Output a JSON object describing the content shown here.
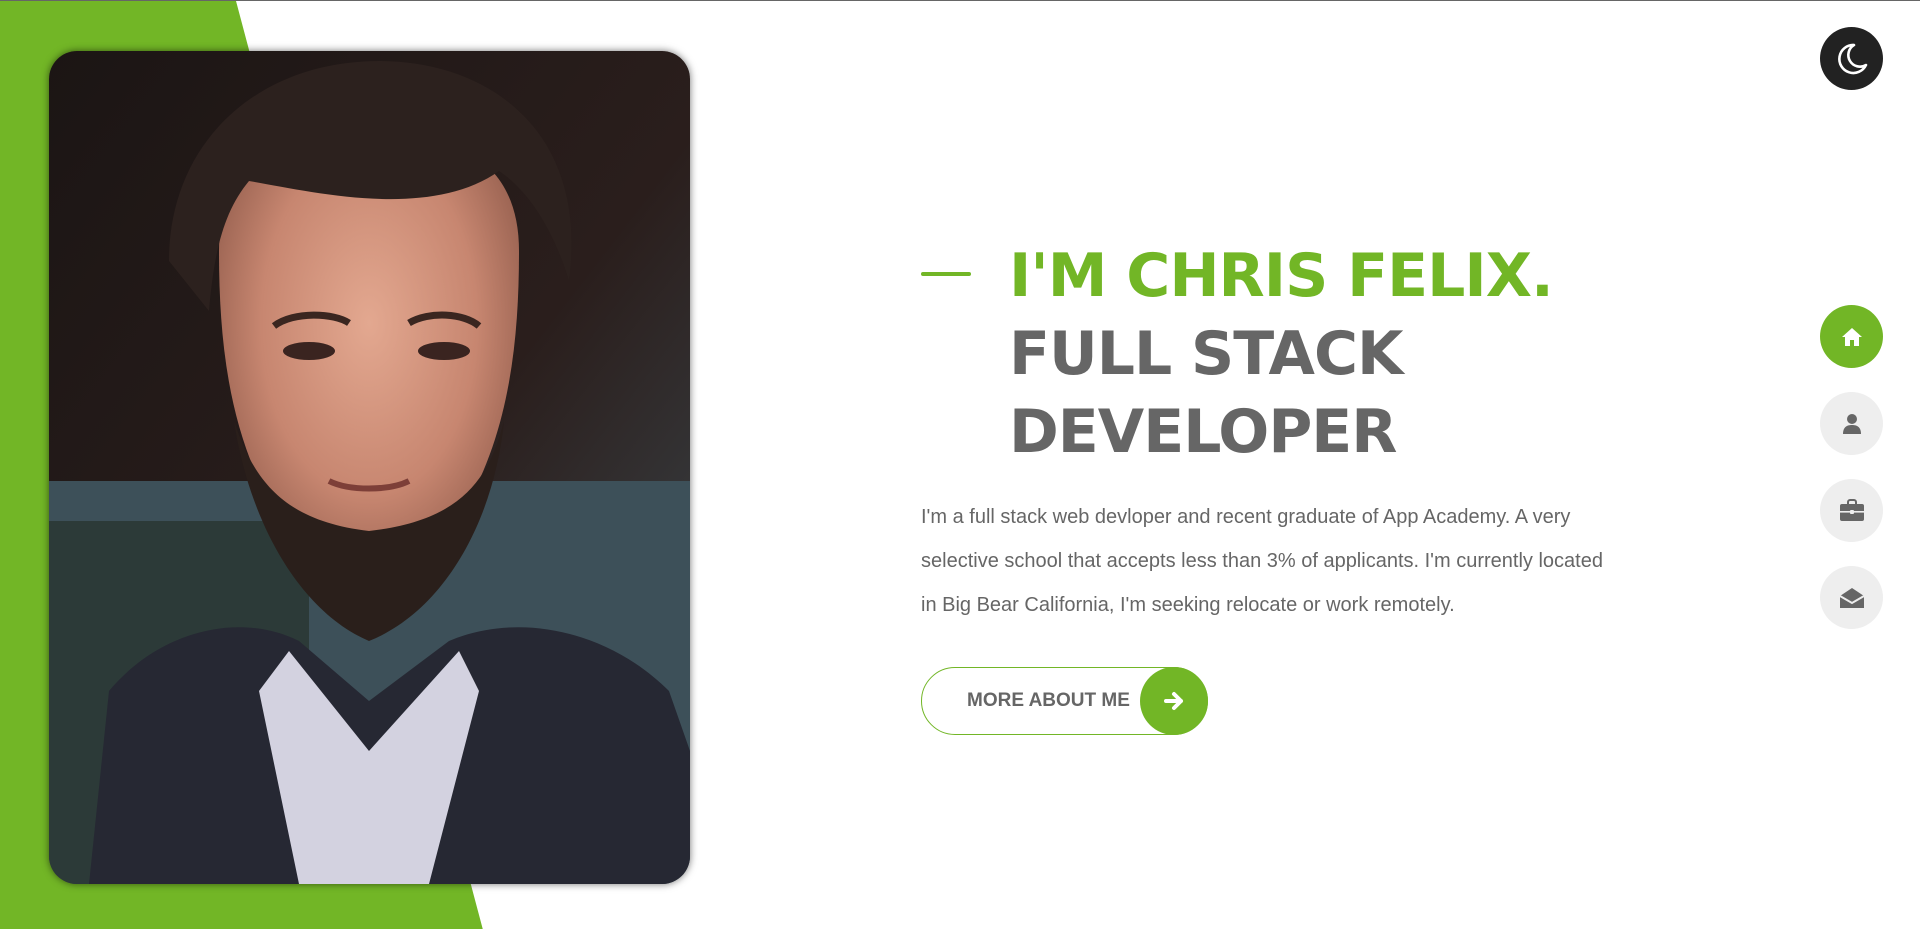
{
  "theme_toggle": {
    "icon": "moon-icon",
    "icon_color": "#ffffff",
    "bg_color": "#222222"
  },
  "hero": {
    "name_line": "I'M CHRIS FELIX.",
    "role_line_1": "FULL STACK",
    "role_line_2": "DEVELOPER",
    "bio": "I'm a full stack web devloper and recent graduate of App Academy. A very selective school that accepts less than 3% of applicants. I'm currently located in Big Bear California, I'm seeking relocate or work remotely.",
    "cta_label": "MORE ABOUT ME",
    "cta_icon": "arrow-right-icon"
  },
  "nav": {
    "items": [
      {
        "icon": "home-icon",
        "active": true
      },
      {
        "icon": "user-icon",
        "active": false
      },
      {
        "icon": "briefcase-icon",
        "active": false
      },
      {
        "icon": "envelope-open-icon",
        "active": false
      }
    ]
  },
  "colors": {
    "accent": "#72b626",
    "text_gray": "#666666",
    "nav_bg": "#eeeeee",
    "nav_icon": "#666666",
    "dark": "#222222"
  }
}
